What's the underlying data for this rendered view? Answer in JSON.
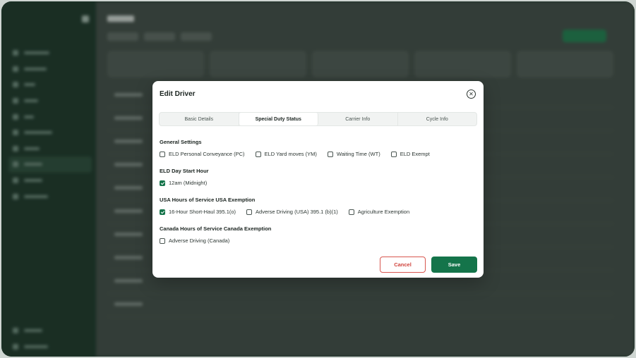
{
  "modal": {
    "title": "Edit Driver",
    "close_icon": "close-icon",
    "tabs": [
      {
        "label": "Basic Details",
        "active": false
      },
      {
        "label": "Special Duty Status",
        "active": true
      },
      {
        "label": "Carrier Info",
        "active": false
      },
      {
        "label": "Cycle Info",
        "active": false
      }
    ],
    "sections": {
      "general": {
        "title": "General Settings",
        "options": [
          {
            "label": "ELD Personal Conveyance (PC)",
            "checked": false
          },
          {
            "label": "ELD Yard moves (YM)",
            "checked": false
          },
          {
            "label": "Waiting Time (WT)",
            "checked": false
          },
          {
            "label": "ELD Exempt",
            "checked": false
          }
        ]
      },
      "day_start": {
        "title": "ELD Day Start Hour",
        "options": [
          {
            "label": "12am (Midnight)",
            "checked": true
          }
        ]
      },
      "usa": {
        "title": "USA Hours of Service USA Exemption",
        "options": [
          {
            "label": "16-Hour Short-Haul 395.1(o)",
            "checked": true
          },
          {
            "label": "Adverse Driving (USA) 395.1 (b)(1)",
            "checked": false
          },
          {
            "label": "Agriculture Exemption",
            "checked": false
          }
        ]
      },
      "canada": {
        "title": "Canada Hours of Service Canada Exemption",
        "options": [
          {
            "label": "Adverse Driving (Canada)",
            "checked": false
          }
        ]
      }
    },
    "cancel_label": "Cancel",
    "save_label": "Save"
  },
  "colors": {
    "primary": "#14744a",
    "danger": "#d0433c",
    "sidebar": "#1c3528"
  }
}
